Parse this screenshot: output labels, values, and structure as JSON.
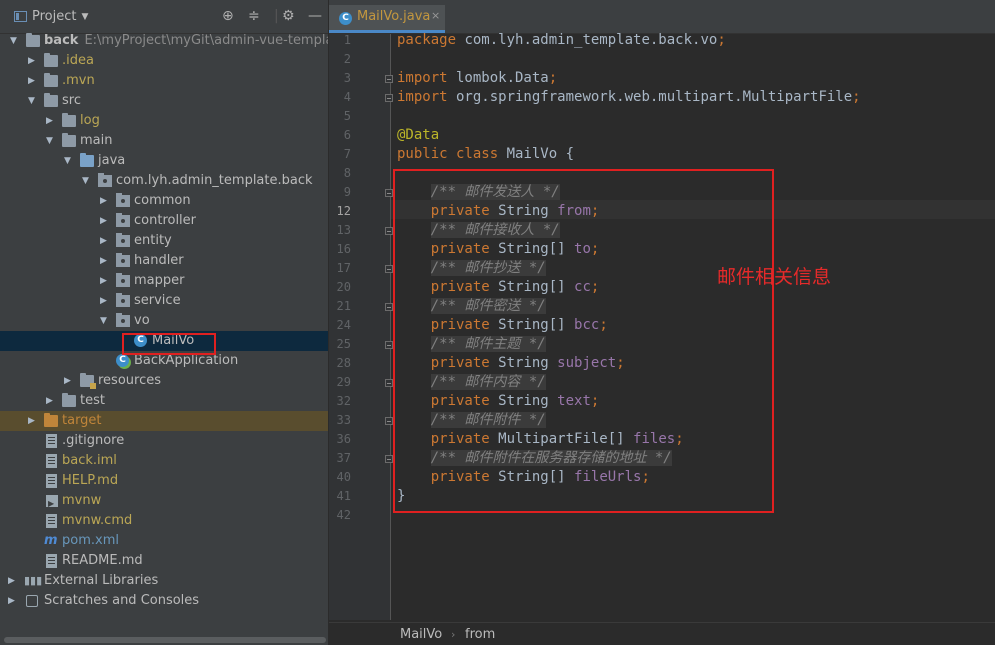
{
  "project_panel": {
    "title": "Project",
    "tree": [
      {
        "label": "back",
        "path": "E:\\myProject\\myGit\\admin-vue-template\\ba",
        "expanded": true,
        "icon": "folder-icon"
      },
      {
        "label": ".idea",
        "expanded": false,
        "icon": "folder-icon"
      },
      {
        "label": ".mvn",
        "expanded": false,
        "icon": "folder-icon"
      },
      {
        "label": "src",
        "expanded": true,
        "icon": "folder-icon"
      },
      {
        "label": "log",
        "expanded": false,
        "icon": "folder-icon"
      },
      {
        "label": "main",
        "expanded": true,
        "icon": "folder-icon"
      },
      {
        "label": "java",
        "expanded": true,
        "icon": "source-folder-icon"
      },
      {
        "label": "com.lyh.admin_template.back",
        "expanded": true,
        "icon": "package-icon"
      },
      {
        "label": "common",
        "expanded": false,
        "icon": "package-icon"
      },
      {
        "label": "controller",
        "expanded": false,
        "icon": "package-icon"
      },
      {
        "label": "entity",
        "expanded": false,
        "icon": "package-icon"
      },
      {
        "label": "handler",
        "expanded": false,
        "icon": "package-icon"
      },
      {
        "label": "mapper",
        "expanded": false,
        "icon": "package-icon"
      },
      {
        "label": "service",
        "expanded": false,
        "icon": "package-icon"
      },
      {
        "label": "vo",
        "expanded": true,
        "icon": "package-icon"
      },
      {
        "label": "MailVo",
        "icon": "class-icon",
        "selected": true
      },
      {
        "label": "BackApplication",
        "icon": "spring-class-icon"
      },
      {
        "label": "resources",
        "expanded": false,
        "icon": "resources-folder-icon"
      },
      {
        "label": "test",
        "expanded": false,
        "icon": "folder-icon"
      },
      {
        "label": "target",
        "expanded": false,
        "icon": "excluded-folder-icon"
      },
      {
        "label": ".gitignore",
        "icon": "file-icon"
      },
      {
        "label": "back.iml",
        "icon": "file-icon"
      },
      {
        "label": "HELP.md",
        "icon": "markdown-icon"
      },
      {
        "label": "mvnw",
        "icon": "script-icon"
      },
      {
        "label": "mvnw.cmd",
        "icon": "file-icon"
      },
      {
        "label": "pom.xml",
        "icon": "maven-icon"
      },
      {
        "label": "README.md",
        "icon": "markdown-icon"
      },
      {
        "label": "External Libraries",
        "expanded": false,
        "icon": "libraries-icon"
      },
      {
        "label": "Scratches and Consoles",
        "expanded": false,
        "icon": "scratches-icon"
      }
    ]
  },
  "editor": {
    "tab_label": "MailVo.java",
    "lines": [
      {
        "n": "1",
        "text": "package com.lyh.admin_template.back.vo;"
      },
      {
        "n": "2",
        "text": ""
      },
      {
        "n": "3",
        "text": "import lombok.Data;"
      },
      {
        "n": "4",
        "text": "import org.springframework.web.multipart.MultipartFile;"
      },
      {
        "n": "5",
        "text": ""
      },
      {
        "n": "6",
        "text": "@Data"
      },
      {
        "n": "7",
        "text": "public class MailVo {"
      },
      {
        "n": "8",
        "text": ""
      },
      {
        "n": "9",
        "text": "    /** 邮件发送人 */"
      },
      {
        "n": "12",
        "text": "    private String from;"
      },
      {
        "n": "13",
        "text": "    /** 邮件接收人 */"
      },
      {
        "n": "16",
        "text": "    private String[] to;"
      },
      {
        "n": "17",
        "text": "    /** 邮件抄送 */"
      },
      {
        "n": "20",
        "text": "    private String[] cc;"
      },
      {
        "n": "21",
        "text": "    /** 邮件密送 */"
      },
      {
        "n": "24",
        "text": "    private String[] bcc;"
      },
      {
        "n": "25",
        "text": "    /** 邮件主题 */"
      },
      {
        "n": "28",
        "text": "    private String subject;"
      },
      {
        "n": "29",
        "text": "    /** 邮件内容 */"
      },
      {
        "n": "32",
        "text": "    private String text;"
      },
      {
        "n": "33",
        "text": "    /** 邮件附件 */"
      },
      {
        "n": "36",
        "text": "    private MultipartFile[] files;"
      },
      {
        "n": "37",
        "text": "    /** 邮件附件在服务器存储的地址 */"
      },
      {
        "n": "40",
        "text": "    private String[] fileUrls;"
      },
      {
        "n": "41",
        "text": "}"
      },
      {
        "n": "42",
        "text": ""
      }
    ],
    "annotation": "邮件相关信息"
  },
  "breadcrumb": {
    "class_name": "MailVo",
    "member": "from"
  },
  "colors": {
    "annotation_red": "#e62a2a",
    "keyword": "#cc7832",
    "field": "#9876aa",
    "comment": "#808080"
  }
}
